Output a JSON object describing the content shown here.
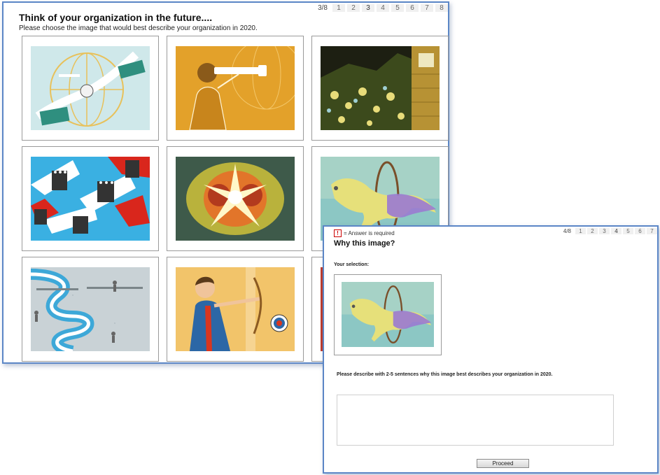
{
  "screen1": {
    "title": "Think of your organization in the future....",
    "subtitle": "Please choose the image that would best describe your organization in 2020.",
    "pager": {
      "counter": "3/8",
      "steps": [
        "1",
        "2",
        "3",
        "4",
        "5",
        "6",
        "7",
        "8"
      ],
      "active": "3"
    },
    "images": [
      {
        "name": "globe-handshake-image"
      },
      {
        "name": "telescope-businessman-image"
      },
      {
        "name": "stock-exchange-image"
      },
      {
        "name": "crowd-arrows-image"
      },
      {
        "name": "head-explosion-image"
      },
      {
        "name": "horse-hoop-image"
      },
      {
        "name": "winding-road-image"
      },
      {
        "name": "archer-target-image"
      },
      {
        "name": "partial-image"
      }
    ]
  },
  "screen2": {
    "required_note": "= Answer is required",
    "required_marker": "!",
    "title": "Why this image?",
    "selection_label": "Your selection:",
    "prompt": "Please describe with 2-5 sentences why this image best describes your organization in 2020.",
    "answer_value": "",
    "proceed_label": "Proceed",
    "pager": {
      "counter": "4/8",
      "steps": [
        "1",
        "2",
        "3",
        "4",
        "5",
        "6",
        "7"
      ],
      "active": "4"
    }
  },
  "colors": {
    "frame": "#5b86c6",
    "pager_active": "#c8c8c8"
  }
}
